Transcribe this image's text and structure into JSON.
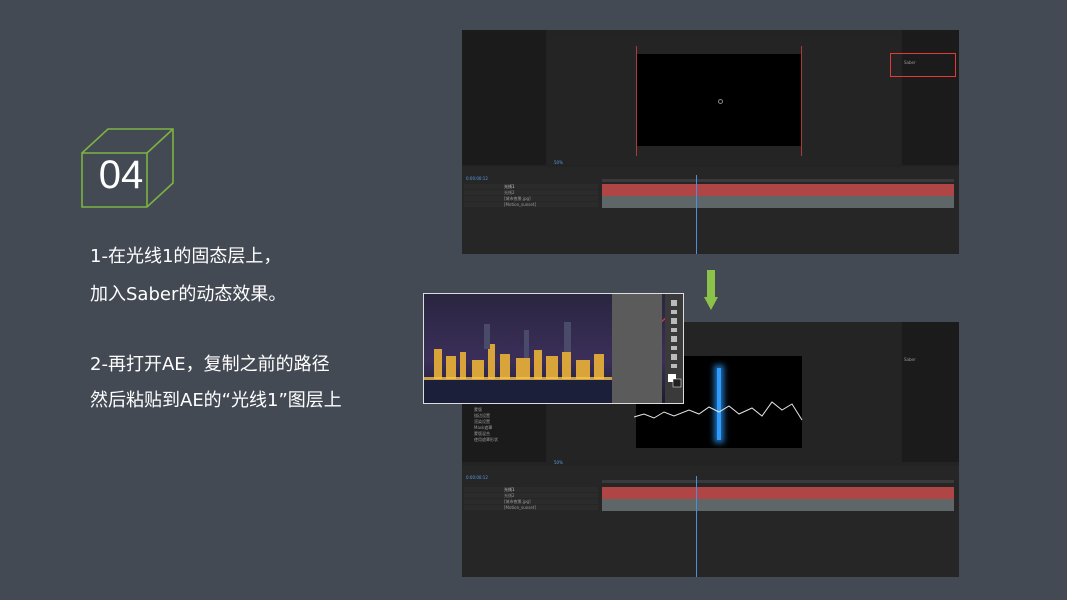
{
  "step": {
    "number": "04"
  },
  "description": {
    "line1": "1-在光线1的固态层上，",
    "line2": "加入Saber的动态效果。",
    "line3": "2-再打开AE，复制之前的路径",
    "line4": "然后粘贴到AE的“光线1”图层上"
  },
  "colors": {
    "background": "#444a54",
    "cube": "#7cb342",
    "arrow": "#8bc34a",
    "highlight": "#e53935",
    "layer_red": "#b04545",
    "layer_gray": "#5f6668",
    "saber_blue": "#2e9bff"
  },
  "screenshot1": {
    "layers": [
      "光线1",
      "光线2",
      "[城市夜景.jpg]",
      "[Motion_sunset]"
    ],
    "effect_label": "Saber",
    "zoom": "50%",
    "time": "0:00:00:12"
  },
  "screenshot2": {
    "layers": [
      "光线1",
      "光线2",
      "[城市夜景.jpg]",
      "[Motion_sunset]"
    ],
    "effect_label": "Saber",
    "properties": [
      "蒙版",
      "描边设置",
      "渲染设置",
      "Mask遮罩",
      "蒙版混合",
      "使用遮罩形状"
    ],
    "zoom": "50%",
    "time": "0:00:00:12"
  },
  "icons": [
    "cube-icon",
    "down-arrow-icon",
    "toolbar-icons"
  ]
}
